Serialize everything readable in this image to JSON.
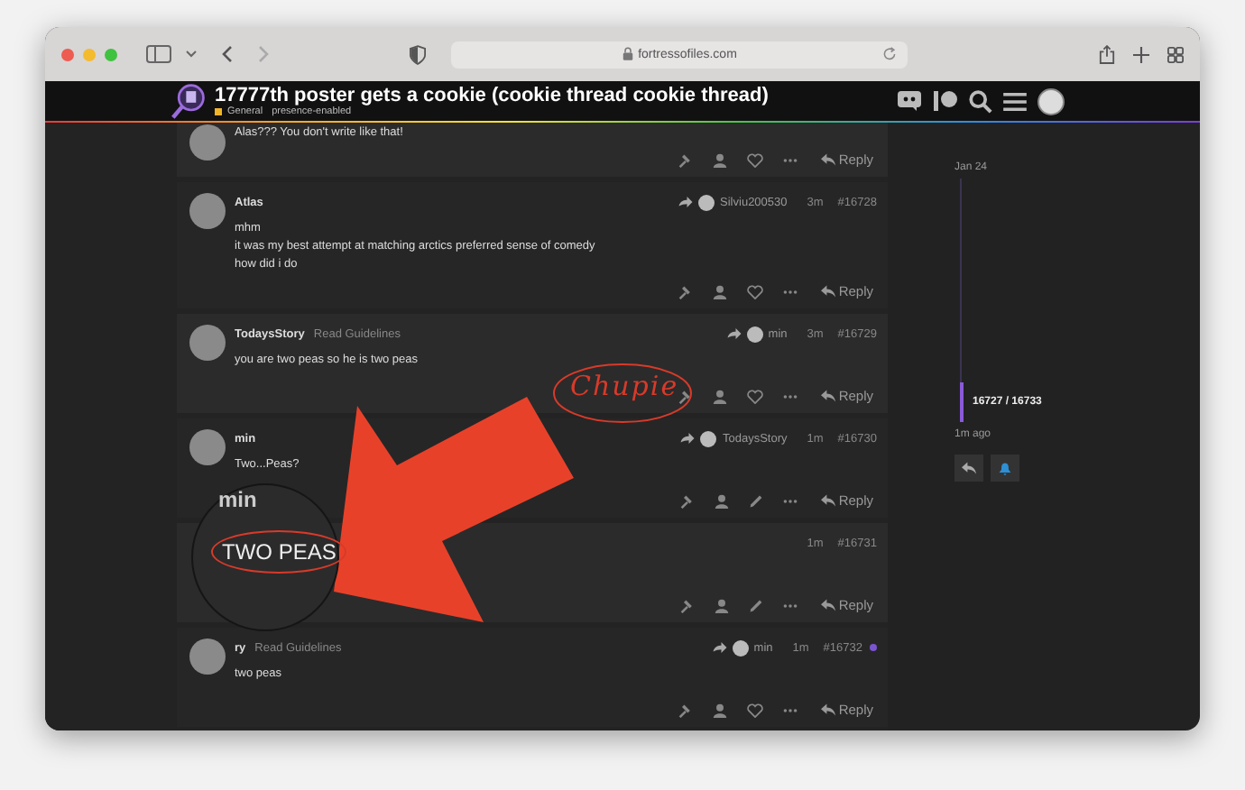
{
  "browser": {
    "url": "fortressofiles.com"
  },
  "site": {
    "title": "17777th poster gets a cookie (cookie thread cookie thread)",
    "category": "General",
    "tag": "presence-enabled"
  },
  "posts": [
    {
      "lines": [
        "Alas??? You don't write like that!"
      ],
      "own": false,
      "reply": "Reply"
    },
    {
      "author": "Atlas",
      "reply_to": "Silviu200530",
      "time": "3m",
      "number": "#16728",
      "lines": [
        "mhm",
        "it was my best attempt at matching arctics preferred sense of comedy",
        "how did i do"
      ],
      "own": false,
      "reply": "Reply"
    },
    {
      "author": "TodaysStory",
      "badge": "Read Guidelines",
      "reply_to": "min",
      "time": "3m",
      "number": "#16729",
      "lines": [
        "you are two peas so he is two peas"
      ],
      "own": false,
      "reply": "Reply"
    },
    {
      "author": "min",
      "reply_to": "TodaysStory",
      "time": "1m",
      "number": "#16730",
      "lines": [
        "Two...Peas?"
      ],
      "own": true,
      "reply": "Reply"
    },
    {
      "time": "1m",
      "number": "#16731",
      "own": true,
      "reply": "Reply"
    },
    {
      "author": "ry",
      "badge": "Read Guidelines",
      "reply_to": "min",
      "time": "1m",
      "number": "#16732",
      "lines": [
        "two peas"
      ],
      "own": false,
      "unread": true,
      "reply": "Reply"
    }
  ],
  "timeline": {
    "date": "Jan 24",
    "position": "16727 / 16733",
    "ago": "1m ago"
  },
  "magnifier": {
    "author": "min",
    "text": "TWO PEAS"
  },
  "annotation": {
    "text": "Chupie"
  }
}
